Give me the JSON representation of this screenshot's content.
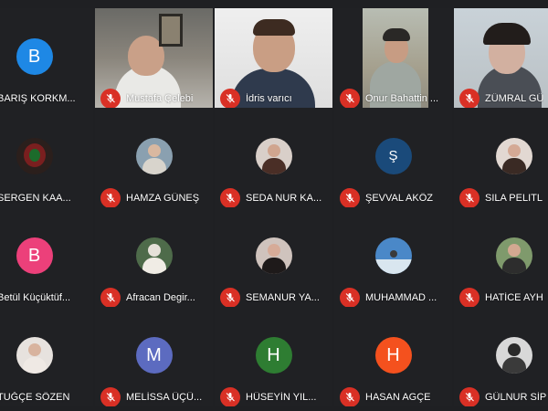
{
  "colors": {
    "mic_muted": "#d93025",
    "background": "#202124"
  },
  "rows": [
    [
      {
        "name": "BARIŞ KORKM...",
        "avatar": "letter",
        "letter": "B",
        "color": "#1e88e5"
      },
      {
        "name": "Mustafa Çelebi",
        "avatar": "video"
      },
      {
        "name": "İdris varıcı",
        "avatar": "video"
      },
      {
        "name": "Onur Bahattin ...",
        "avatar": "video"
      },
      {
        "name": "ZÜMRAL GÜ",
        "avatar": "video"
      }
    ],
    [
      {
        "name": "SERGEN KAA...",
        "avatar": "photo"
      },
      {
        "name": "HAMZA GÜNEŞ",
        "avatar": "photo"
      },
      {
        "name": "SEDA NUR KA...",
        "avatar": "photo"
      },
      {
        "name": "ŞEVVAL AKÖZ",
        "avatar": "letter",
        "letter": "Ş",
        "color": "#1a4a7a"
      },
      {
        "name": "SILA PELITL",
        "avatar": "photo"
      }
    ],
    [
      {
        "name": "Betül Küçüktüf...",
        "avatar": "letter",
        "letter": "B",
        "color": "#ec407a"
      },
      {
        "name": "Afracan Degir...",
        "avatar": "photo"
      },
      {
        "name": "SEMANUR YA...",
        "avatar": "photo"
      },
      {
        "name": "MUHAMMAD ...",
        "avatar": "photo"
      },
      {
        "name": "HATİCE AYH",
        "avatar": "photo"
      }
    ],
    [
      {
        "name": "TUĞÇE SÖZEN",
        "avatar": "photo"
      },
      {
        "name": "MELİSSA ÜÇÜ...",
        "avatar": "letter",
        "letter": "M",
        "color": "#5c6bc0"
      },
      {
        "name": "HÜSEYİN YIL...",
        "avatar": "letter",
        "letter": "H",
        "color": "#2e7d32"
      },
      {
        "name": "HASAN AGÇE",
        "avatar": "letter",
        "letter": "H",
        "color": "#f4511e"
      },
      {
        "name": "GÜLNUR SİP",
        "avatar": "photo"
      }
    ]
  ]
}
